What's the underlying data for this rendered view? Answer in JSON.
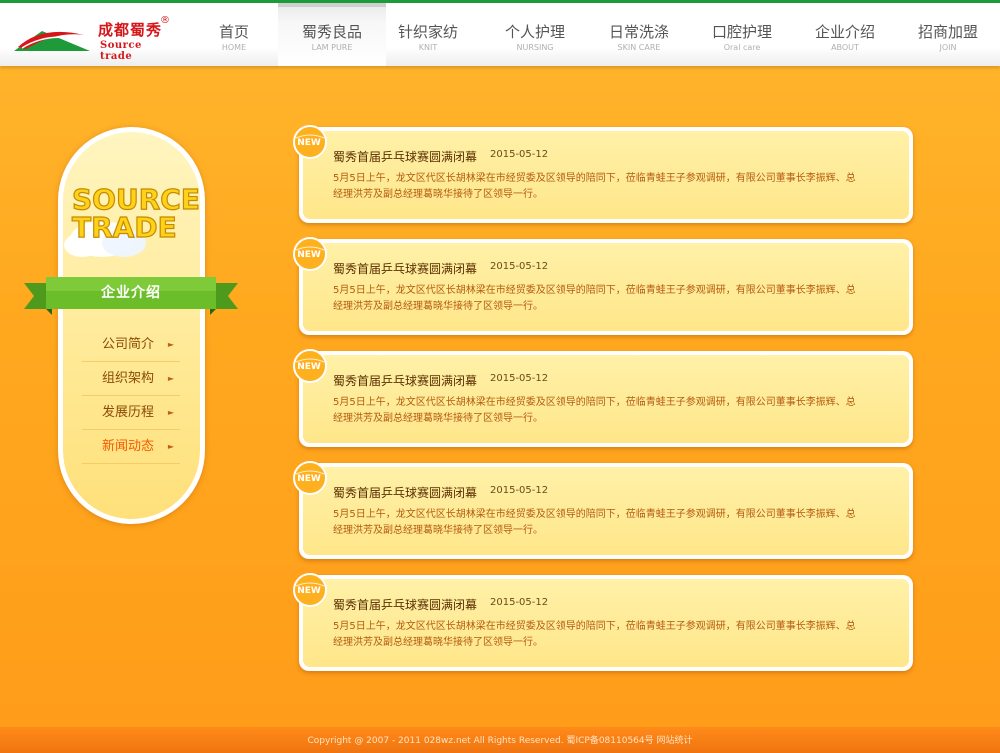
{
  "logo": {
    "cn": "成都蜀秀",
    "reg": "®",
    "en": "Source trade"
  },
  "nav": {
    "items": [
      {
        "cn": "首页",
        "en": "HOME"
      },
      {
        "cn": "蜀秀良品",
        "en": "LAM PURE"
      },
      {
        "cn": "针织家纺",
        "en": "KNIT"
      },
      {
        "cn": "个人护理",
        "en": "NURSING"
      },
      {
        "cn": "日常洗涤",
        "en": "SKIN CARE"
      },
      {
        "cn": "口腔护理",
        "en": "Oral care"
      },
      {
        "cn": "企业介绍",
        "en": "ABOUT"
      },
      {
        "cn": "招商加盟",
        "en": "JOIN"
      }
    ],
    "active_index": 1
  },
  "sidebar": {
    "art_line1": "SOURCE",
    "art_line2": "TRADE",
    "section_title": "企业介绍",
    "items": [
      {
        "label": "公司简介"
      },
      {
        "label": "组织架构"
      },
      {
        "label": "发展历程"
      },
      {
        "label": "新闻动态"
      }
    ],
    "current_index": 3,
    "arrow_glyph": "►"
  },
  "news": {
    "badge": "NEW",
    "items": [
      {
        "title": "蜀秀首届乒乓球赛圆满闭幕",
        "date": "2015-05-12",
        "summary": "5月5日上午，龙文区代区长胡林梁在市经贸委及区领导的陪同下，莅临青蛙王子参观调研，有限公司董事长李振辉、总经理洪芳及副总经理葛晓华接待了区领导一行。"
      },
      {
        "title": "蜀秀首届乒乓球赛圆满闭幕",
        "date": "2015-05-12",
        "summary": "5月5日上午，龙文区代区长胡林梁在市经贸委及区领导的陪同下，莅临青蛙王子参观调研，有限公司董事长李振辉、总经理洪芳及副总经理葛晓华接待了区领导一行。"
      },
      {
        "title": "蜀秀首届乒乓球赛圆满闭幕",
        "date": "2015-05-12",
        "summary": "5月5日上午，龙文区代区长胡林梁在市经贸委及区领导的陪同下，莅临青蛙王子参观调研，有限公司董事长李振辉、总经理洪芳及副总经理葛晓华接待了区领导一行。"
      },
      {
        "title": "蜀秀首届乒乓球赛圆满闭幕",
        "date": "2015-05-12",
        "summary": "5月5日上午，龙文区代区长胡林梁在市经贸委及区领导的陪同下，莅临青蛙王子参观调研，有限公司董事长李振辉、总经理洪芳及副总经理葛晓华接待了区领导一行。"
      },
      {
        "title": "蜀秀首届乒乓球赛圆满闭幕",
        "date": "2015-05-12",
        "summary": "5月5日上午，龙文区代区长胡林梁在市经贸委及区领导的陪同下，莅临青蛙王子参观调研，有限公司董事长李振辉、总经理洪芳及副总经理葛晓华接待了区领导一行。"
      }
    ]
  },
  "footer": {
    "text": "Copyright @ 2007 - 2011 028wz.net All Rights Reserved. 蜀ICP备08110564号 网站统计"
  },
  "colors": {
    "brand_red": "#d6171a",
    "brand_green": "#1f9a3a",
    "page_orange": "#ffa91f",
    "card_yellow": "#ffe68a",
    "current_menu": "#f45a00"
  }
}
